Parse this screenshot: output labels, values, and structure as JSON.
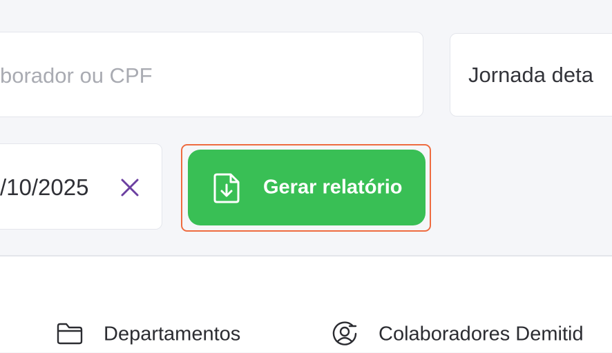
{
  "filters": {
    "search_placeholder": "borador ou CPF",
    "report_type_value": "Jornada deta",
    "date_range_value": "/10/2025"
  },
  "actions": {
    "generate_report_label": "Gerar relatório"
  },
  "tabs": [
    {
      "label": "Departamentos",
      "icon": "folder-icon"
    },
    {
      "label": "Colaboradores Demitid",
      "icon": "user-circle-icon"
    }
  ],
  "colors": {
    "accent_green": "#39bf55",
    "focus_ring": "#ee6b3f",
    "clear_icon": "#6b3fa0",
    "placeholder": "#a9abb2"
  }
}
